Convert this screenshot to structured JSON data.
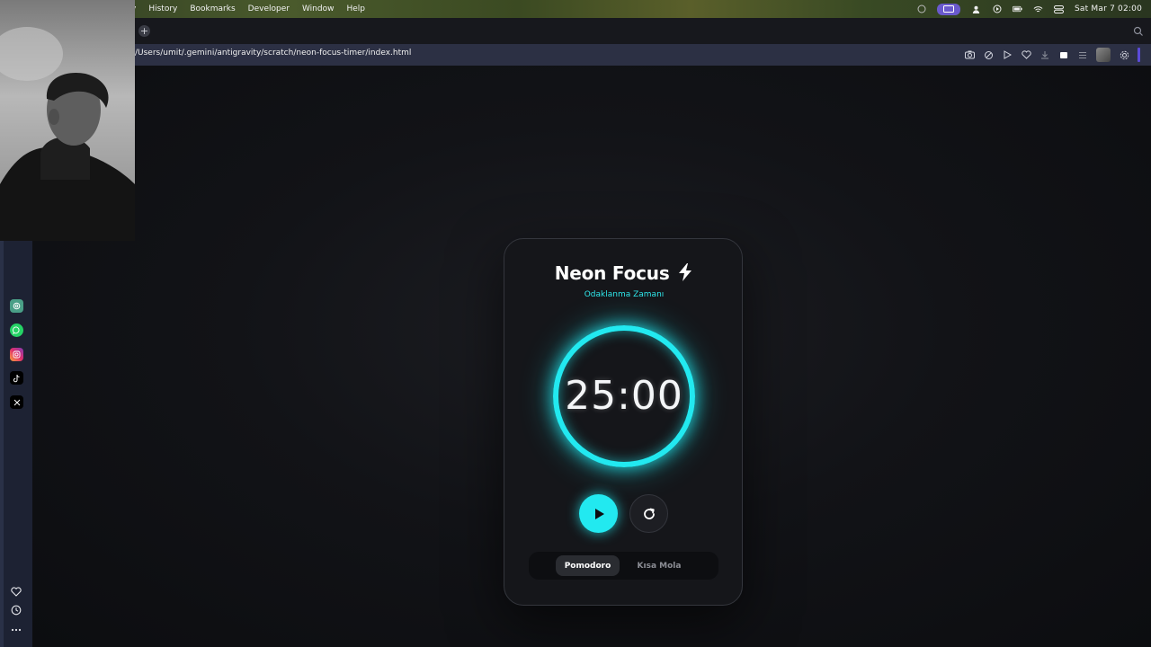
{
  "menubar": {
    "partial_item": "y",
    "items": [
      "History",
      "Bookmarks",
      "Developer",
      "Window",
      "Help"
    ],
    "clock": "Sat Mar 7  02:00",
    "tray_icons": [
      "screen-share-icon",
      "user-icon",
      "record-icon",
      "battery-icon",
      "wifi-icon",
      "control-center-icon"
    ]
  },
  "browser": {
    "url": "/Users/umit/.gemini/antigravity/scratch/neon-focus-timer/index.html",
    "toolbar_icons": [
      "camera-icon",
      "extensions-icon",
      "play-icon",
      "heart-icon",
      "download-icon",
      "stop-icon",
      "menu-icon",
      "profile-avatar",
      "settings-icon"
    ]
  },
  "sidebar": {
    "apps": [
      "chatgpt-icon",
      "whatsapp-icon",
      "instagram-icon",
      "tiktok-icon",
      "x-icon"
    ],
    "bottom": [
      "heart-icon",
      "history-icon",
      "more-icon"
    ]
  },
  "app": {
    "title": "Neon Focus",
    "subtitle": "Odaklanma Zamanı",
    "time": "25:00",
    "accent": "#22e9f0",
    "modes": [
      {
        "label": "Pomodoro",
        "active": true
      },
      {
        "label": "Kısa Mola",
        "active": false
      }
    ]
  }
}
